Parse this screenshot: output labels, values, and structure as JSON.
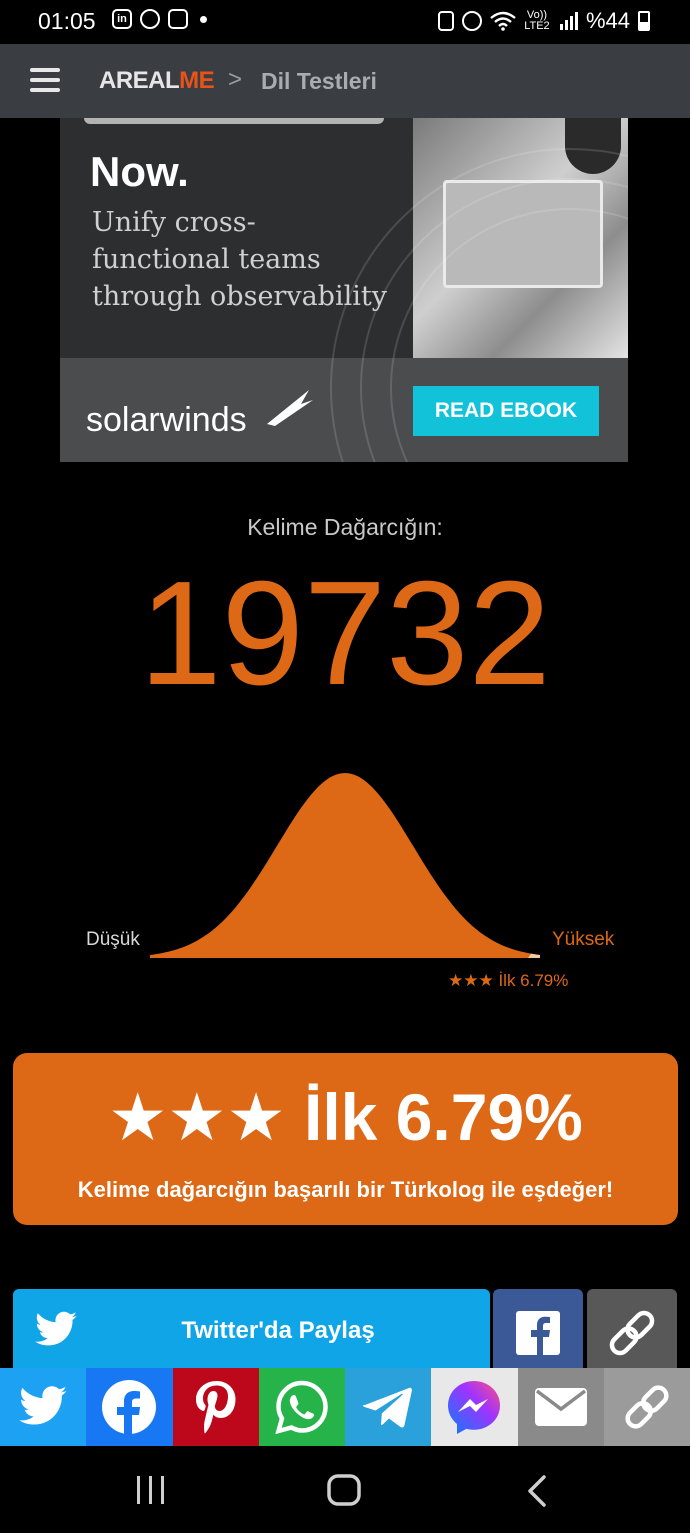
{
  "status_bar": {
    "time": "01:05",
    "battery": "%44",
    "network": "Vo)) LTE2"
  },
  "nav": {
    "logo_part1": "AREAL",
    "logo_part2": "ME",
    "separator": ">",
    "breadcrumb": "Dil Testleri"
  },
  "ad": {
    "title": "Now.",
    "subtitle": "Unify cross-functional teams through observability",
    "brand": "solarwinds",
    "cta": "READ EBOOK"
  },
  "result": {
    "label": "Kelime Dağarcığın:",
    "score": "19732",
    "low_label": "Düşük",
    "high_label": "Yüksek",
    "rank_small": "★★★ İlk 6.79%",
    "rank_percent": 6.79
  },
  "card": {
    "rank": "★★★ İlk 6.79%",
    "description": "Kelime dağarcığın başarılı bir Türkolog ile eşdeğer!"
  },
  "share": {
    "twitter_label": "Twitter'da Paylaş"
  },
  "share_bar": [
    {
      "name": "twitter",
      "icon": "twitter-icon",
      "color": "#1da1f2"
    },
    {
      "name": "facebook",
      "icon": "facebook-icon",
      "color": "#1877f2"
    },
    {
      "name": "pinterest",
      "icon": "pinterest-icon",
      "color": "#bd081c"
    },
    {
      "name": "whatsapp",
      "icon": "whatsapp-icon",
      "color": "#25d366"
    },
    {
      "name": "telegram",
      "icon": "telegram-icon",
      "color": "#2aa1da"
    },
    {
      "name": "messenger",
      "icon": "messenger-icon",
      "color": "#e8e8e8"
    },
    {
      "name": "email",
      "icon": "email-icon",
      "color": "#8a8a8a"
    },
    {
      "name": "copy-link",
      "icon": "link-icon",
      "color": "#9b9b9b"
    }
  ],
  "colors": {
    "accent": "#dd6816",
    "navbar": "#3a3d42",
    "twitter": "#10a5e7",
    "facebook": "#3b5897"
  }
}
